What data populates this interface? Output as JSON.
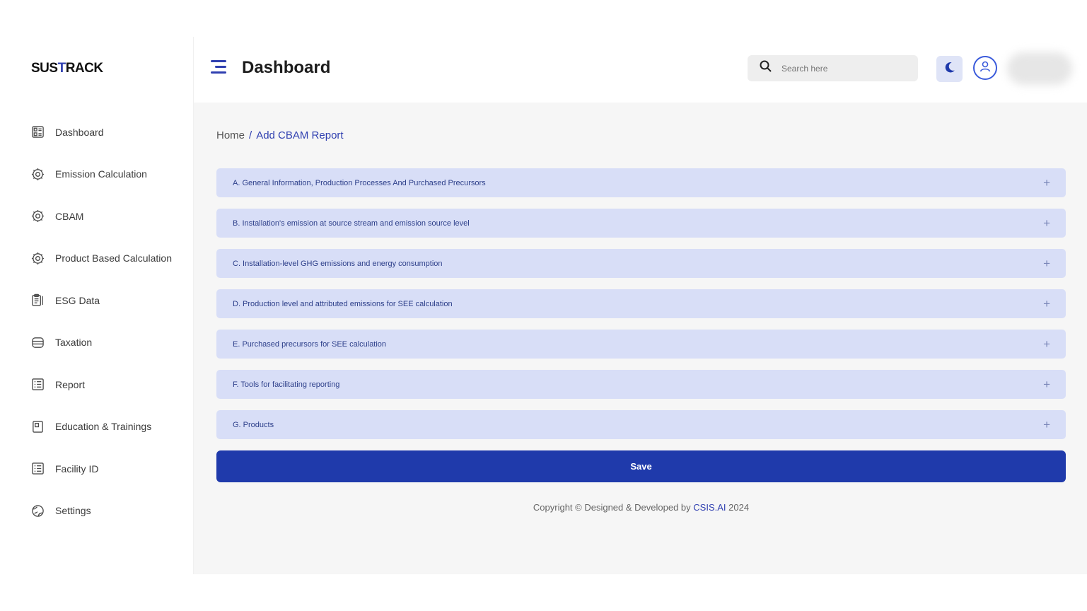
{
  "brand": {
    "logo_pre": "SUS",
    "logo_t": "T",
    "logo_post": "RACK"
  },
  "sidebar": {
    "items": [
      {
        "label": "Dashboard",
        "icon": "dashboard-icon"
      },
      {
        "label": "Emission Calculation",
        "icon": "gear-icon"
      },
      {
        "label": "CBAM",
        "icon": "gear-icon"
      },
      {
        "label": "Product Based Calculation",
        "icon": "gear-icon"
      },
      {
        "label": "ESG Data",
        "icon": "clipboard-icon"
      },
      {
        "label": "Taxation",
        "icon": "database-icon"
      },
      {
        "label": "Report",
        "icon": "list-icon"
      },
      {
        "label": "Education & Trainings",
        "icon": "book-icon"
      },
      {
        "label": "Facility ID",
        "icon": "list-icon"
      },
      {
        "label": "Settings",
        "icon": "settings-globe-icon"
      }
    ]
  },
  "header": {
    "title": "Dashboard",
    "search_placeholder": "Search here"
  },
  "breadcrumb": {
    "home": "Home",
    "separator": "/",
    "current": "Add CBAM Report"
  },
  "accordion": {
    "items": [
      {
        "title": "A. General Information, Production Processes And Purchased Precursors"
      },
      {
        "title": "B. Installation's emission at source stream and emission source level"
      },
      {
        "title": "C. Installation-level GHG emissions and energy consumption"
      },
      {
        "title": "D. Production level and attributed emissions for SEE calculation"
      },
      {
        "title": "E. Purchased precursors for SEE calculation"
      },
      {
        "title": "F. Tools for facilitating reporting"
      },
      {
        "title": "G. Products"
      }
    ],
    "expand_symbol": "+"
  },
  "save_label": "Save",
  "footer": {
    "prefix": "Copyright © Designed & Developed by ",
    "brand": "CSIS.AI",
    "year": " 2024"
  },
  "colors": {
    "accent": "#1f3aab",
    "accordion_bg": "#d8def7",
    "main_bg": "#f6f6f6"
  }
}
